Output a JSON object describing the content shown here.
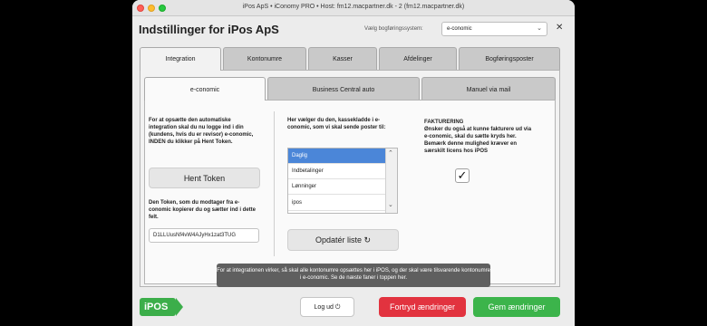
{
  "window": {
    "title": "iPos ApS • iConomy PRO • Host: fm12.macpartner.dk - 2 (fm12.macpartner.dk)"
  },
  "header": {
    "title": "Indstillinger for iPos ApS",
    "system_label": "Vælg bogføringssystem:",
    "system_value": "e-conomic",
    "close_icon": "✕"
  },
  "main_tabs": [
    {
      "label": "Integration",
      "active": true
    },
    {
      "label": "Kontonumre"
    },
    {
      "label": "Kasser"
    },
    {
      "label": "Afdelinger"
    },
    {
      "label": "Bogføringsposter"
    }
  ],
  "sub_tabs": [
    {
      "label": "e-conomic",
      "active": true
    },
    {
      "label": "Business Central auto"
    },
    {
      "label": "Manuel via mail"
    }
  ],
  "left": {
    "intro": "For at opsætte den automatiske integration skal du nu logge ind i din (kundens, hvis du er revisor) e-conomic, INDEN du klikker på Hent Token.",
    "get_token_button": "Hent Token",
    "token_help": "Den Token, som du modtager fra e-conomic kopierer du og sætter ind i dette felt.",
    "token_value": "D1LLUusNf4vW4AJyHx1zat3TUG"
  },
  "middle": {
    "intro": "Her vælger du den, kassekladde i e-conomic, som vi skal sende poster til:",
    "options": [
      "Daglig",
      "Indbetalinger",
      "Lønninger",
      "ipos"
    ],
    "selected": "Daglig",
    "refresh_button": "Opdatér liste",
    "refresh_icon": "↻"
  },
  "right": {
    "heading": "FAKTURERING",
    "text": "Ønsker du også at kunne fakturere ud via e-conomic, skal du sætte kryds her. Bemærk denne mulighed kræver en særskilt licens hos iPOS",
    "checked": true,
    "check_icon": "✓"
  },
  "tooltip": "For at integrationen virker, så skal alle kontonumre opsættes her i iPOS, og der skal være tilsvarende kontonumre i e-conomic. Se de næste faner i toppen her.",
  "footer": {
    "logo": "iPOS",
    "logout_label": "Log ud",
    "logout_icon": "⏻",
    "cancel_label": "Fortryd ændringer",
    "save_label": "Gem ændringer"
  },
  "colors": {
    "brand_green": "#3cae4a",
    "danger_red": "#e2333f",
    "selection_blue": "#4b86d8"
  }
}
